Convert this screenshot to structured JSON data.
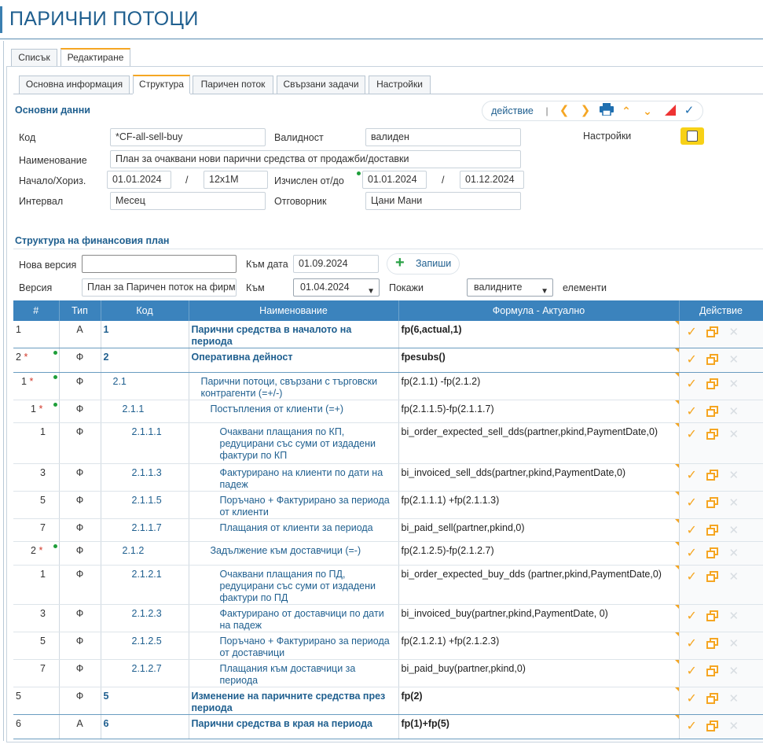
{
  "page": {
    "title": "ПАРИЧНИ ПОТОЦИ"
  },
  "outer_tabs": [
    {
      "label": "Списък"
    },
    {
      "label": "Редактиране"
    }
  ],
  "inner_tabs": [
    {
      "label": "Основна информация"
    },
    {
      "label": "Структура"
    },
    {
      "label": "Паричен поток"
    },
    {
      "label": "Свързани задачи"
    },
    {
      "label": "Настройки"
    }
  ],
  "basic": {
    "section_title": "Основни данни",
    "toolbar": {
      "action_label": "действие",
      "separator": "|"
    },
    "code_label": "Код",
    "code_value": "*CF-all-sell-buy",
    "validity_label": "Валидност",
    "validity_value": "валиден",
    "settings_label": "Настройки",
    "name_label": "Наименование",
    "name_value": "План за очаквани нови парични средства от  продажби/доставки",
    "start_label": "Начало/Хориз.",
    "start_value": "01.01.2024",
    "slash": "/",
    "horizon_value": "12x1M",
    "computed_label": "Изчислен от/до",
    "computed_from": "01.01.2024",
    "computed_to": "01.12.2024",
    "interval_label": "Интервал",
    "interval_value": "Месец",
    "owner_label": "Отговорник",
    "owner_value": "Цани Мани"
  },
  "structure": {
    "section_title": "Структура на финансовия план",
    "new_version_label": "Нова версия",
    "new_version_value": "",
    "to_date_label": "Към дата",
    "to_date_value": "01.09.2024",
    "save_label": "Запиши",
    "version_label": "Версия",
    "version_value": "План за Паричен поток на фирма",
    "to_label": "Към",
    "to_value": "01.04.2024",
    "show_label": "Покажи",
    "show_value": "валидните",
    "elements_label": "елементи"
  },
  "table": {
    "headers": [
      "#",
      "Тип",
      "Код",
      "Наименование",
      "Формула - Актуално",
      "Действие"
    ],
    "rows": [
      {
        "num": "1",
        "star": "",
        "type": "А",
        "code": "1",
        "name": "Парични средства в началото на периода",
        "formula": "fp(6,actual,1)",
        "bold": true,
        "level": 0,
        "dot": false
      },
      {
        "num": "2",
        "star": "*",
        "type": "Ф",
        "code": "2",
        "name": "Оперативна дейност",
        "formula": "fpesubs()",
        "bold": true,
        "level": 0,
        "dot": true
      },
      {
        "num": "1",
        "star": "*",
        "type": "Ф",
        "code": "2.1",
        "name": "Парични потоци, свързани с търговски контрагенти (=+/-)",
        "formula": "fp(2.1.1) -fp(2.1.2)",
        "bold": false,
        "level": 1,
        "dot": true
      },
      {
        "num": "1",
        "star": "*",
        "type": "Ф",
        "code": "2.1.1",
        "name": "Постъпления от клиенти (=+)",
        "formula": "fp(2.1.1.5)-fp(2.1.1.7)",
        "bold": false,
        "level": 2,
        "dot": true
      },
      {
        "num": "1",
        "star": "",
        "type": "Ф",
        "code": "2.1.1.1",
        "name": "Очаквани плащания по КП, редуцирани със суми от издадени фактури по КП",
        "formula": "bi_order_expected_sell_dds(partner,pkind,PaymentDate,0)",
        "bold": false,
        "level": 3,
        "dot": false
      },
      {
        "num": "3",
        "star": "",
        "type": "Ф",
        "code": "2.1.1.3",
        "name": "Фактурирано на клиенти по дати на падеж",
        "formula": "bi_invoiced_sell_dds(partner,pkind,PaymentDate,0)",
        "bold": false,
        "level": 3,
        "dot": false
      },
      {
        "num": "5",
        "star": "",
        "type": "Ф",
        "code": "2.1.1.5",
        "name": "Поръчано + Фактурирано за периода от клиенти",
        "formula": "fp(2.1.1.1) +fp(2.1.1.3)",
        "bold": false,
        "level": 3,
        "dot": false
      },
      {
        "num": "7",
        "star": "",
        "type": "Ф",
        "code": "2.1.1.7",
        "name": "Плащания от клиенти за периода",
        "formula": "bi_paid_sell(partner,pkind,0)",
        "bold": false,
        "level": 3,
        "dot": false
      },
      {
        "num": "2",
        "star": "*",
        "type": "Ф",
        "code": "2.1.2",
        "name": "Задължение към доставчици (=-)",
        "formula": "fp(2.1.2.5)-fp(2.1.2.7)",
        "bold": false,
        "level": 2,
        "dot": true
      },
      {
        "num": "1",
        "star": "",
        "type": "Ф",
        "code": "2.1.2.1",
        "name": "Очаквани плащания по ПД, редуцирани със суми от издадени фактури по ПД",
        "formula": "bi_order_expected_buy_dds (partner,pkind,PaymentDate,0)",
        "bold": false,
        "level": 3,
        "dot": false
      },
      {
        "num": "3",
        "star": "",
        "type": "Ф",
        "code": "2.1.2.3",
        "name": "Фактурирано от доставчици по дати на падеж",
        "formula": "bi_invoiced_buy(partner,pkind,PaymentDate, 0)",
        "bold": false,
        "level": 3,
        "dot": false
      },
      {
        "num": "5",
        "star": "",
        "type": "Ф",
        "code": "2.1.2.5",
        "name": "Поръчано + Фактурирано за периода от доставчици",
        "formula": "fp(2.1.2.1) +fp(2.1.2.3)",
        "bold": false,
        "level": 3,
        "dot": false
      },
      {
        "num": "7",
        "star": "",
        "type": "Ф",
        "code": "2.1.2.7",
        "name": "Плащания към доставчици за периода",
        "formula": "bi_paid_buy(partner,pkind,0)",
        "bold": false,
        "level": 3,
        "dot": false
      },
      {
        "num": "5",
        "star": "",
        "type": "Ф",
        "code": "5",
        "name": "Изменение на паричните средства през периода",
        "formula": "fp(2)",
        "bold": true,
        "level": 0,
        "dot": false
      },
      {
        "num": "6",
        "star": "",
        "type": "А",
        "code": "6",
        "name": "Парични средства в края на периода",
        "formula": "fp(1)+fp(5)",
        "bold": true,
        "level": 0,
        "dot": false
      }
    ]
  },
  "colors": {
    "accent": "#1f5f8f",
    "header_bg": "#3b83bd",
    "action_orange": "#f5a623",
    "green": "#2aa146",
    "red": "#d23b2c"
  }
}
